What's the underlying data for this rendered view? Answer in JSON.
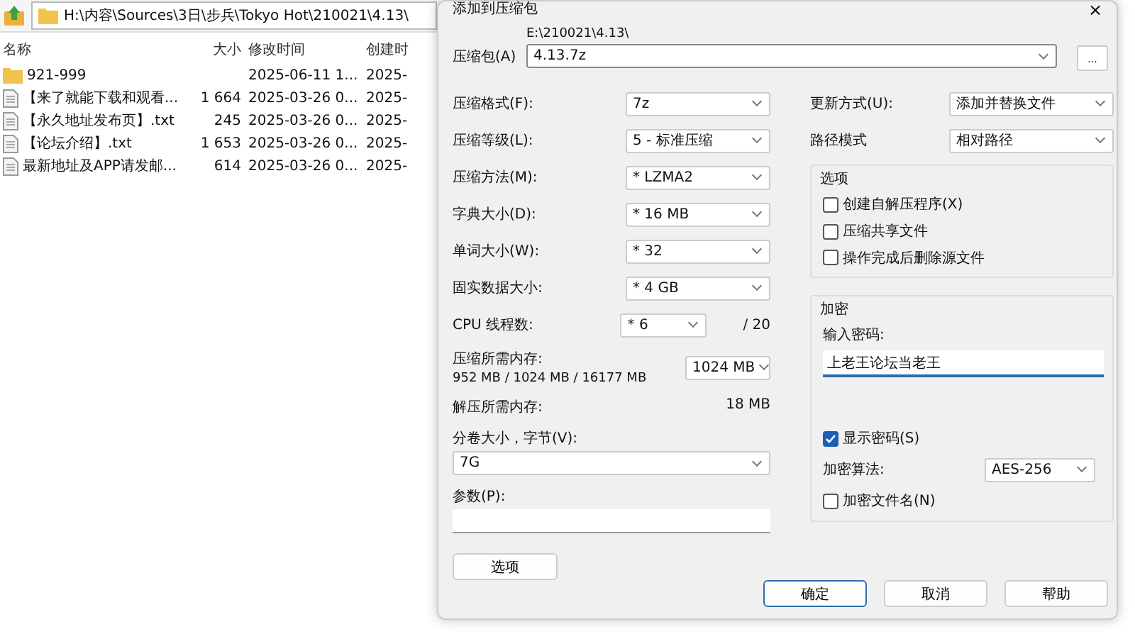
{
  "file_manager": {
    "address": "H:\\内容\\Sources\\3日\\步兵\\Tokyo Hot\\210021\\4.13\\",
    "columns": [
      "名称",
      "大小",
      "修改时间",
      "创建时"
    ],
    "rows": [
      {
        "kind": "folder",
        "name": "921-999",
        "modified": "2025-06-11 1...",
        "created": "2025-"
      },
      {
        "kind": "file",
        "name": "【来了就能下载和观看...",
        "size": "1 664",
        "modified": "2025-03-26 0...",
        "created": "2025-"
      },
      {
        "kind": "file",
        "name": "【永久地址发布页】.txt",
        "size": "245",
        "modified": "2025-03-26 0...",
        "created": "2025-"
      },
      {
        "kind": "file",
        "name": "【论坛介绍】.txt",
        "size": "1 653",
        "modified": "2025-03-26 0...",
        "created": "2025-"
      },
      {
        "kind": "file",
        "name": "最新地址及APP请发邮...",
        "size": "614",
        "modified": "2025-03-26 0...",
        "created": "2025-"
      }
    ]
  },
  "dialog": {
    "title": "添加到压缩包",
    "close": "×",
    "archive": {
      "label": "压缩包(A)",
      "path": "E:\\210021\\4.13\\",
      "value": "4.13.7z",
      "browse": "..."
    },
    "left_rows": [
      {
        "kind": "combo",
        "label": "压缩格式(F):",
        "value": "7z"
      },
      {
        "kind": "combo",
        "label": "压缩等级(L):",
        "value": "5 - 标准压缩"
      },
      {
        "kind": "combo",
        "label": "压缩方法(M):",
        "value": "*  LZMA2"
      },
      {
        "kind": "combo",
        "label": "字典大小(D):",
        "value": "*  16 MB"
      },
      {
        "kind": "combo",
        "label": "单词大小(W):",
        "value": "*  32"
      },
      {
        "kind": "combo",
        "label": "固实数据大小:",
        "value": "*  4 GB"
      },
      {
        "kind": "cpu",
        "label": "CPU 线程数:",
        "value": "*  6",
        "suffix": "/ 20"
      }
    ],
    "memory": {
      "label": "压缩所需内存:",
      "detail": "952 MB / 1024 MB / 16177 MB",
      "value": "1024 MB"
    },
    "decompress": {
      "label": "解压所需内存:",
      "value": "18 MB"
    },
    "split": {
      "label": "分卷大小，字节(V):",
      "value": "7G"
    },
    "params": {
      "label": "参数(P):"
    },
    "options_button": "选项",
    "right_rows": [
      {
        "label": "更新方式(U):",
        "value": "添加并替换文件"
      },
      {
        "label": "路径模式",
        "value": "相对路径"
      }
    ],
    "options_group": {
      "title": "选项",
      "items": [
        {
          "label": "创建自解压程序(X)",
          "checked": false
        },
        {
          "label": "压缩共享文件",
          "checked": false
        },
        {
          "label": "操作完成后删除源文件",
          "checked": false
        }
      ]
    },
    "encryption": {
      "title": "加密",
      "password_label": "输入密码:",
      "password": "上老王论坛当老王",
      "show_password": {
        "label": "显示密码(S)",
        "checked": true
      },
      "method_label": "加密算法:",
      "method": "AES-256",
      "encrypt_names": {
        "label": "加密文件名(N)",
        "checked": false
      }
    },
    "buttons": [
      {
        "label": "确定",
        "selected": true
      },
      {
        "label": "取消",
        "selected": false
      },
      {
        "label": "帮助",
        "selected": false
      }
    ]
  }
}
